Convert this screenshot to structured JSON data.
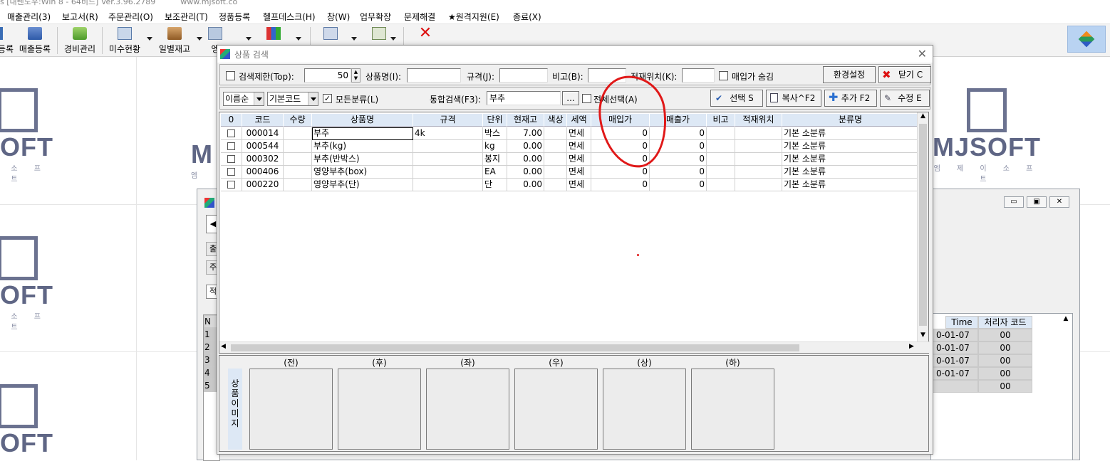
{
  "app": {
    "title_text": "s [내렌도우:Win 8 - 64비드] Ver.3.96.2789          www.mjsoft.co",
    "menu": [
      "매출관리(3)",
      "보고서(R)",
      "주문관리(O)",
      "보조관리(T)",
      "정품등록",
      "헬프데스크(H)",
      "창(W)",
      "업무확장",
      "문제해결",
      "★원격지원(E)",
      "종료(X)"
    ],
    "toolbar": [
      "등록",
      "매출등록",
      "경비관리",
      "미수현황",
      "일별재고",
      "엥",
      "",
      "",
      "",
      "",
      ""
    ]
  },
  "logos": {
    "word": "MJSOFT",
    "word_partial": "SOFT",
    "word_stub": "M",
    "sub": "엠 제 이 소 프 트",
    "sub_partial": "이 소 프 트",
    "sub_stub": "엠"
  },
  "bg_window": {
    "header_left": "N",
    "header_time": "Time",
    "header_user": "처리자 코드",
    "side_tabs": [
      "출",
      "주",
      "적"
    ],
    "row_nums": [
      "1",
      "2",
      "3",
      "4",
      "5"
    ],
    "rows": [
      {
        "time": "0-01-07",
        "user": "00"
      },
      {
        "time": "0-01-07",
        "user": "00"
      },
      {
        "time": "0-01-07",
        "user": "00"
      },
      {
        "time": "0-01-07",
        "user": "00"
      },
      {
        "time": "",
        "user": "00"
      }
    ]
  },
  "dialog": {
    "title": "상품 검색",
    "search_limit_label": "검색제한(Top):",
    "search_limit_value": "50",
    "product_name_label": "상품명(I):",
    "spec_label": "규격(J):",
    "note_label": "비고(B):",
    "location_label": "적재위치(K):",
    "hide_purchase_label": "매입가 숨김",
    "env_button": "환경설정",
    "close_button": "닫기 C",
    "sort_select": "이름순",
    "code_select": "기본코드",
    "all_category_label": "모든분류(L)",
    "unified_search_label": "통합검색(F3):",
    "unified_search_value": "부추",
    "ellipsis": "...",
    "select_all_label": "전체선택(A)",
    "select_button": "선택 S",
    "copy_button": "복사^F2",
    "add_button": "추가 F2",
    "edit_button": "수정 E"
  },
  "grid": {
    "columns": [
      "0",
      "코드",
      "수량",
      "상품명",
      "규격",
      "단위",
      "현재고",
      "색상",
      "세액",
      "매입가",
      "매출가",
      "비고",
      "적재위치",
      "분류명"
    ],
    "rows": [
      {
        "code": "000014",
        "qty": "",
        "name": "부추",
        "spec": "4k",
        "unit": "박스",
        "stock": "7.00",
        "color": "",
        "tax": "면세",
        "buy": "0",
        "sell": "0",
        "note": "",
        "loc": "",
        "cat": "기본 소분류"
      },
      {
        "code": "000544",
        "qty": "",
        "name": "부추(kg)",
        "spec": "",
        "unit": "kg",
        "stock": "0.00",
        "color": "",
        "tax": "면세",
        "buy": "0",
        "sell": "0",
        "note": "",
        "loc": "",
        "cat": "기본 소분류"
      },
      {
        "code": "000302",
        "qty": "",
        "name": "부추(반박스)",
        "spec": "",
        "unit": "봉지",
        "stock": "0.00",
        "color": "",
        "tax": "면세",
        "buy": "0",
        "sell": "0",
        "note": "",
        "loc": "",
        "cat": "기본 소분류"
      },
      {
        "code": "000406",
        "qty": "",
        "name": "영양부추(box)",
        "spec": "",
        "unit": "EA",
        "stock": "0.00",
        "color": "",
        "tax": "면세",
        "buy": "0",
        "sell": "0",
        "note": "",
        "loc": "",
        "cat": "기본 소분류"
      },
      {
        "code": "000220",
        "qty": "",
        "name": "영양부추(단)",
        "spec": "",
        "unit": "단",
        "stock": "0.00",
        "color": "",
        "tax": "면세",
        "buy": "0",
        "sell": "0",
        "note": "",
        "loc": "",
        "cat": "기본 소분류"
      }
    ]
  },
  "image_panel": {
    "side_label": "상품 이미지",
    "captions": [
      "(전)",
      "(후)",
      "(좌)",
      "(우)",
      "(상)",
      "(하)"
    ]
  },
  "colors": {
    "annotation": "#e01818",
    "header_blue": "#dde8f5"
  }
}
